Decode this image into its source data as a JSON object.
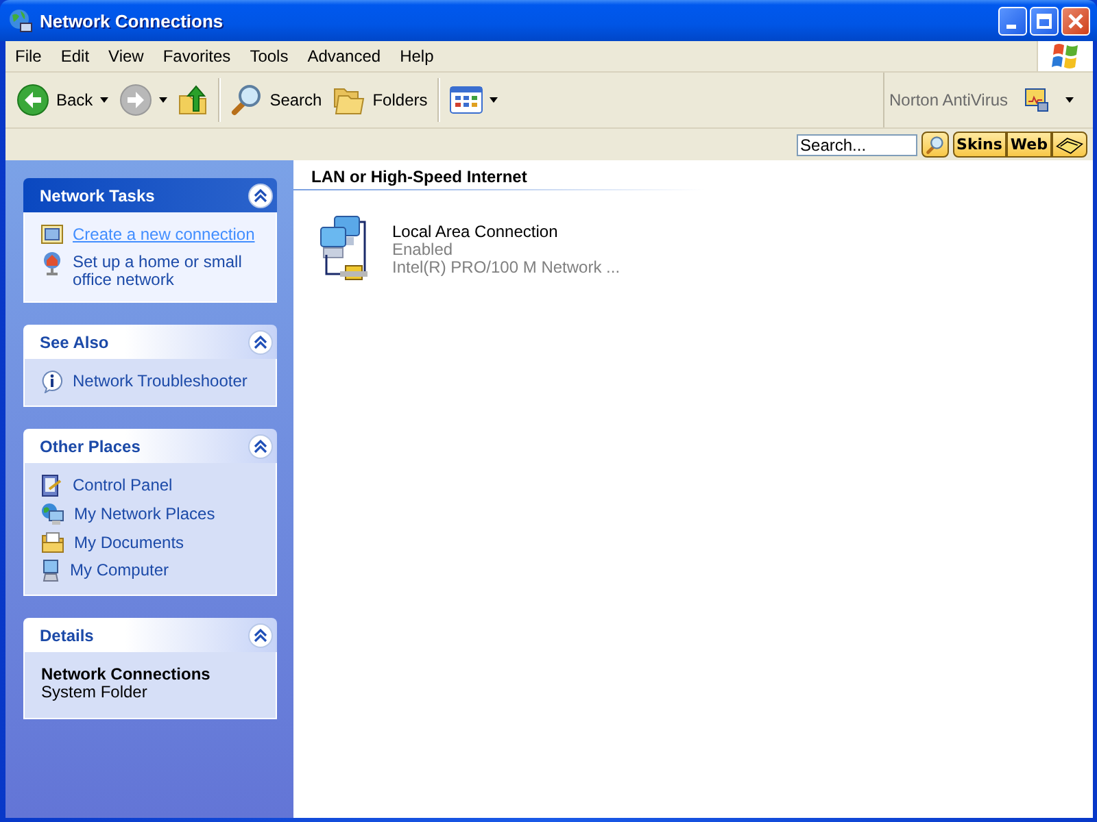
{
  "window": {
    "title": "Network Connections"
  },
  "menu": [
    "File",
    "Edit",
    "View",
    "Favorites",
    "Tools",
    "Advanced",
    "Help"
  ],
  "toolbar": {
    "buttons": [
      {
        "kind": "back",
        "label": "Back",
        "disabled": false,
        "dropdown": true
      },
      {
        "kind": "forward",
        "disabled": true,
        "dropdown": true
      },
      {
        "kind": "up",
        "disabled": false,
        "dropdown": false
      },
      {
        "kind": "search",
        "label": "Search",
        "disabled": false,
        "dropdown": false
      },
      {
        "kind": "folders",
        "label": "Folders",
        "disabled": false,
        "dropdown": false
      },
      {
        "kind": "views",
        "disabled": false,
        "dropdown": true
      }
    ],
    "plugin": {
      "label": "Norton AntiVirus"
    }
  },
  "searchbar": {
    "placeholder": "Search...",
    "buttons": [
      {
        "kind": "search"
      },
      {
        "kind": "text",
        "label": "Skins"
      },
      {
        "kind": "text",
        "label": "Web"
      },
      {
        "kind": "book"
      }
    ]
  },
  "panels": [
    {
      "title": "Network Tasks",
      "kind": "special",
      "expanded": true,
      "items": [
        {
          "kind": "wizard",
          "label": "Create a new connection",
          "hovered": true
        },
        {
          "kind": "home",
          "label": "Set up a home or small office network",
          "hovered": false
        }
      ]
    },
    {
      "title": "See Also",
      "kind": "normal",
      "expanded": true,
      "items": [
        {
          "kind": "info",
          "label": "Network Troubleshooter",
          "hovered": false
        }
      ]
    },
    {
      "title": "Other Places",
      "kind": "normal",
      "expanded": true,
      "items": [
        {
          "kind": "control-panel",
          "label": "Control Panel",
          "hovered": false
        },
        {
          "kind": "network-places",
          "label": "My Network Places",
          "hovered": false
        },
        {
          "kind": "documents",
          "label": "My Documents",
          "hovered": false
        },
        {
          "kind": "computer",
          "label": "My Computer",
          "hovered": false
        }
      ]
    },
    {
      "title": "Details",
      "kind": "details",
      "expanded": true,
      "details": {
        "title": "Network Connections",
        "subtitle": "System Folder"
      }
    }
  ],
  "content": {
    "group": "LAN or High-Speed Internet",
    "items": [
      {
        "name": "Local Area Connection",
        "status": "Enabled",
        "device": "Intel(R) PRO/100 M Network ..."
      }
    ]
  }
}
